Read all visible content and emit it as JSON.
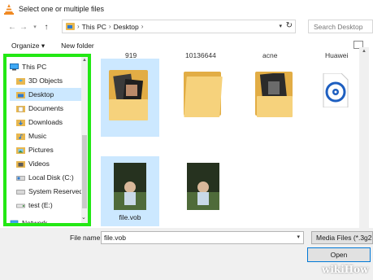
{
  "window": {
    "title": "Select one or multiple files"
  },
  "address_bar": {
    "crumbs": [
      "This PC",
      "Desktop"
    ],
    "search_placeholder": "Search Desktop"
  },
  "toolbar": {
    "organize_label": "Organize ▾",
    "new_folder_label": "New folder"
  },
  "nav_pane": {
    "items": [
      {
        "label": "This PC",
        "icon": "computer-icon"
      },
      {
        "label": "3D Objects",
        "icon": "folder-3d-icon"
      },
      {
        "label": "Desktop",
        "icon": "desktop-folder-icon"
      },
      {
        "label": "Documents",
        "icon": "documents-icon"
      },
      {
        "label": "Downloads",
        "icon": "downloads-icon"
      },
      {
        "label": "Music",
        "icon": "music-icon"
      },
      {
        "label": "Pictures",
        "icon": "pictures-icon"
      },
      {
        "label": "Videos",
        "icon": "videos-icon"
      },
      {
        "label": "Local Disk (C:)",
        "icon": "drive-icon"
      },
      {
        "label": "System Reserved",
        "icon": "drive-icon"
      },
      {
        "label": "test (E:)",
        "icon": "drive-icon"
      },
      {
        "label": "Network",
        "icon": "network-icon"
      }
    ],
    "selected": "Desktop",
    "highlight_color": "#23e814"
  },
  "content": {
    "cut_labels": [
      "919",
      "10136644",
      "acne",
      "Huawei"
    ],
    "files": [
      {
        "label": "",
        "kind": "folder-with-photos"
      },
      {
        "label": "",
        "kind": "folder"
      },
      {
        "label": "",
        "kind": "folder-with-photos"
      },
      {
        "label": "",
        "kind": "disc-app"
      },
      {
        "label": "file.vob",
        "kind": "video-thumbnail"
      },
      {
        "label": "",
        "kind": "video-thumbnail"
      }
    ]
  },
  "bottom_bar": {
    "file_name_label": "File name:",
    "file_name_value": "file.vob",
    "filter_value": "Media Files (*.3g2",
    "open_label": "Open",
    "watermark": "wikiHow"
  },
  "colors": {
    "selection": "#cce8ff",
    "folder": "#f6d27c",
    "accent": "#0078d7"
  }
}
